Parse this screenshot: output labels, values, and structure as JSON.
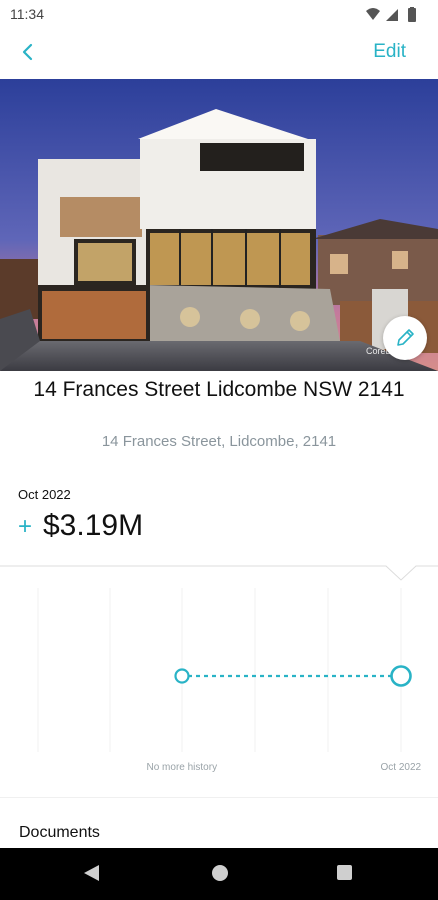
{
  "status_bar": {
    "time": "11:34",
    "icons": [
      "wifi-icon",
      "signal-icon",
      "battery-icon"
    ]
  },
  "app_bar": {
    "back_icon": "chevron-left-icon",
    "edit_label": "Edit",
    "accent_color": "#29b3c6"
  },
  "hero": {
    "photo_credit": "CoreLogic",
    "edit_icon": "pencil-icon"
  },
  "property": {
    "title": "14 Frances Street Lidcombe NSW 2141",
    "address": "14  Frances Street, Lidcombe, 2141"
  },
  "valuation": {
    "date": "Oct 2022",
    "change_sign": "+",
    "amount": "$3.19M"
  },
  "chart_data": {
    "type": "line",
    "title": "",
    "x_labels": [
      "No more history",
      "Oct 2022"
    ],
    "series": [
      {
        "name": "",
        "style": "dashed",
        "color": "#29b3c6",
        "x": [
          "No more history",
          "Oct 2022"
        ],
        "values": [
          3.19,
          3.19
        ]
      }
    ],
    "grid": true,
    "legend": "none"
  },
  "documents": {
    "title": "Documents"
  },
  "nav_bar": {
    "icons": [
      "nav-back-icon",
      "nav-home-icon",
      "nav-recents-icon"
    ]
  }
}
